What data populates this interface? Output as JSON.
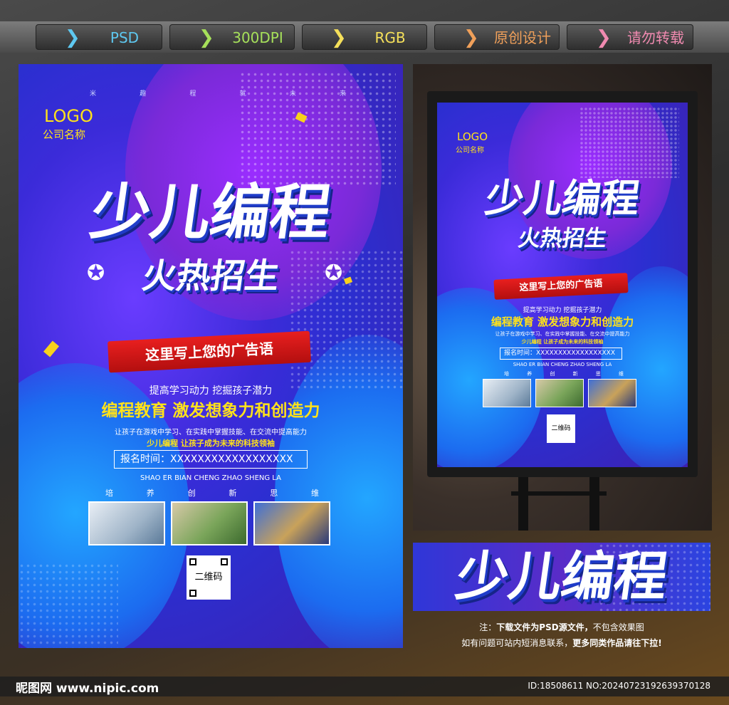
{
  "tabs": [
    "PSD",
    "300DPI",
    "RGB",
    "原创设计",
    "请勿转载"
  ],
  "tab_colors": [
    "#5ec8f0",
    "#a6e05a",
    "#f5e05a",
    "#f0a05a",
    "#f08ab0"
  ],
  "poster": {
    "top_small": [
      "米",
      "趣",
      "程",
      "就",
      "未",
      "来"
    ],
    "logo": "LOGO",
    "company": "公司名称",
    "title": "少儿编程",
    "subtitle": "火热招生",
    "ribbon": "这里写上您的广告语",
    "line1": "提高学习动力 挖掘孩子潜力",
    "headline": "编程教育 激发想象力和创造力",
    "line2": "让孩子在游戏中学习、在实践中掌握技能、在交流中提高能力",
    "line3": "少儿编程 让孩子成为未来的科技领袖",
    "register": "报名时间：XXXXXXXXXXXXXXXXXX",
    "pinyin": "SHAO ER BIAN CHENG ZHAO SHENG LA",
    "values": [
      "培",
      "养",
      "创",
      "新",
      "思",
      "维"
    ],
    "qr_label": "二维码"
  },
  "banner_title": "少儿编程",
  "note": {
    "line1_a": "注：",
    "line1_b": "下载文件为PSD源文件，",
    "line1_c": "不包含效果图",
    "line2_a": "如有问题可站内短消息联系，",
    "line2_b": "更多同类作品请往下拉!"
  },
  "footer": {
    "site": "昵图网 www.nipic.com",
    "id": "ID:18508611 NO:20240723192639370128"
  }
}
